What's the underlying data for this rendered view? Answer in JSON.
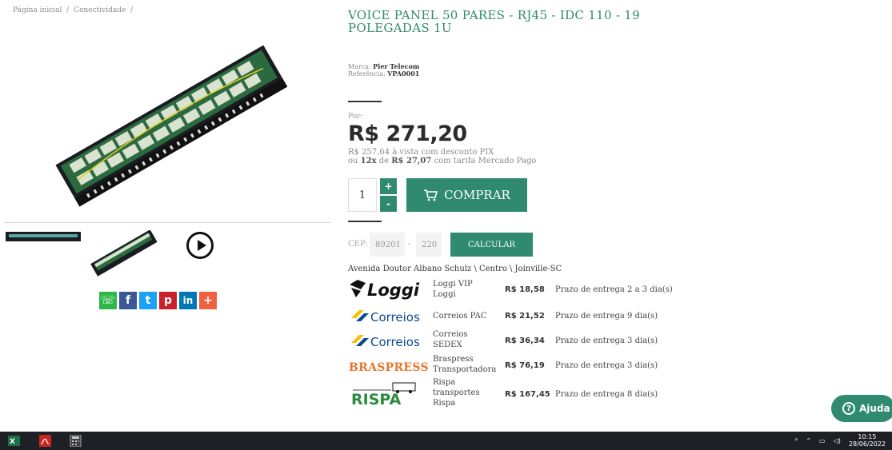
{
  "breadcrumb": {
    "items": [
      "Página inicial",
      "/",
      "Conectividade",
      "/"
    ]
  },
  "product": {
    "title": "VOICE PANEL 50 PARES - RJ45 - IDC 110 - 19 POLEGADAS 1U",
    "brand_label": "Marca:",
    "brand": "Pier Telecom",
    "ref_label": "Referência:",
    "ref": "VPA0001"
  },
  "pricing": {
    "por_label": "Por:",
    "price": "R$ 271,20",
    "pix_price": "R$ 257,64",
    "pix_text": "à vista com desconto PIX",
    "installment_prefix": "ou",
    "installment_count": "12x",
    "installment_mid": "de",
    "installment_value": "R$ 27,07",
    "installment_suffix": "com tarifa Mercado Pago"
  },
  "cart": {
    "quantity": "1",
    "plus": "+",
    "minus": "-",
    "buy_label": "COMPRAR"
  },
  "shipping": {
    "cep_label": "CEP:",
    "cep_part1": "89201",
    "cep_dash": "-",
    "cep_part2": "220",
    "calc_label": "CALCULAR",
    "address": "Avenida Doutor Albano Schulz \\ Centro \\ Joinville-SC",
    "options": [
      {
        "logo": "Loggi",
        "name": "Loggi VIP Loggi",
        "price": "R$ 18,58",
        "prazo": "Prazo de entrega 2 a 3 dia(s)"
      },
      {
        "logo": "Correios",
        "name": "Correios PAC",
        "price": "R$ 21,52",
        "prazo": "Prazo de entrega 9 dia(s)"
      },
      {
        "logo": "Correios",
        "name": "Correios SEDEX",
        "price": "R$ 36,34",
        "prazo": "Prazo de entrega 3 dia(s)"
      },
      {
        "logo": "BRASPRESS",
        "name": "Braspress Transportadora",
        "price": "R$ 76,19",
        "prazo": "Prazo de entrega 3 dia(s)"
      },
      {
        "logo": "RISPA",
        "name": "Rispa transportes Rispa",
        "price": "R$ 167,45",
        "prazo": "Prazo de entrega 8 dia(s)"
      }
    ]
  },
  "share": {
    "icons": [
      "whatsapp-icon",
      "facebook-icon",
      "twitter-icon",
      "pinterest-icon",
      "linkedin-icon",
      "plus-icon"
    ]
  },
  "help": {
    "label": "Ajuda"
  },
  "taskbar": {
    "time": "10:15",
    "date": "28/06/2022"
  },
  "colors": {
    "accent": "#2f8a6f",
    "title": "#2f8a6f",
    "taskbar": "#1f1f26"
  }
}
